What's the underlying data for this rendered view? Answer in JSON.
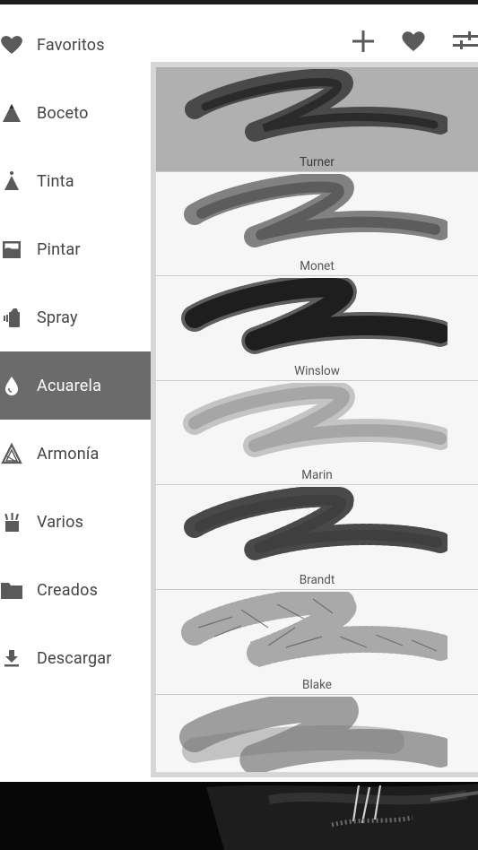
{
  "toolbar": {
    "add_icon": "plus-icon",
    "favorite_icon": "heart-icon",
    "settings_icon": "sliders-icon"
  },
  "sidebar": {
    "items": [
      {
        "label": "Favoritos",
        "icon": "heart-icon"
      },
      {
        "label": "Boceto",
        "icon": "pencil-tip-icon"
      },
      {
        "label": "Tinta",
        "icon": "ink-nib-icon"
      },
      {
        "label": "Pintar",
        "icon": "paint-bucket-icon"
      },
      {
        "label": "Spray",
        "icon": "spray-can-icon"
      },
      {
        "label": "Acuarela",
        "icon": "water-drop-icon"
      },
      {
        "label": "Armonía",
        "icon": "harmony-triangle-icon"
      },
      {
        "label": "Varios",
        "icon": "misc-brushes-icon"
      },
      {
        "label": "Creados",
        "icon": "folder-icon"
      },
      {
        "label": "Descargar",
        "icon": "download-icon"
      }
    ],
    "active": "Acuarela"
  },
  "brushes": {
    "items": [
      {
        "name": "Turner"
      },
      {
        "name": "Monet"
      },
      {
        "name": "Winslow"
      },
      {
        "name": "Marin"
      },
      {
        "name": "Brandt"
      },
      {
        "name": "Blake"
      },
      {
        "name": ""
      }
    ],
    "selected": "Turner"
  },
  "colors": {
    "active_category_bg": "#6b6b6b",
    "selected_brush_bg": "#b0b0b0",
    "list_frame": "#d6d6d6",
    "icon_gray": "#5a5a5a"
  }
}
